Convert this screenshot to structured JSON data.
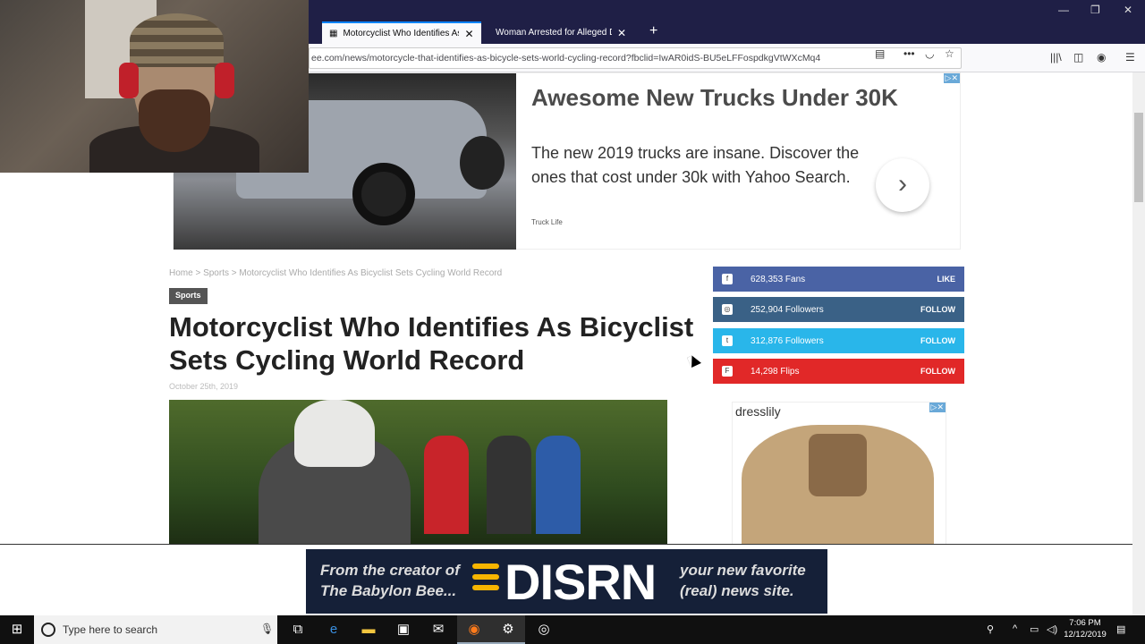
{
  "browser": {
    "tabs": [
      {
        "label": "Motorcyclist Who Identifies As",
        "active": true
      },
      {
        "label": "Woman Arrested for Alleged Death",
        "active": false
      }
    ],
    "new_tab": "+",
    "tab_close": "✕",
    "url": "ee.com/news/motorcycle-that-identifies-as-bicycle-sets-world-cycling-record?fbclid=IwAR0idS-BU5eLFFospdkgVtWXcMq4",
    "window_controls": [
      "—",
      "❐",
      "✕"
    ]
  },
  "top_ad": {
    "title": "Awesome New Trucks Under 30K",
    "text": "The new 2019 trucks are insane. Discover the ones that cost under 30k with Yahoo Search.",
    "source": "Truck Life",
    "arrow": "›",
    "adchoice": "▷✕"
  },
  "article": {
    "breadcrumb": "Home > Sports > Motorcyclist Who Identifies As Bicyclist Sets Cycling World Record",
    "category": "Sports",
    "title": "Motorcyclist Who Identifies As Bicyclist Sets Cycling World Record",
    "date": "October 25th, 2019"
  },
  "social": [
    {
      "icon": "f",
      "count": "628,353 Fans",
      "action": "LIKE",
      "color": "#4a63a5"
    },
    {
      "icon": "◎",
      "count": "252,904 Followers",
      "action": "FOLLOW",
      "color": "#3a6186"
    },
    {
      "icon": "t",
      "count": "312,876 Followers",
      "action": "FOLLOW",
      "color": "#29b6ea"
    },
    {
      "icon": "F",
      "count": "14,298 Flips",
      "action": "FOLLOW",
      "color": "#e12828"
    }
  ],
  "side_ad": {
    "brand": "dresslily",
    "adchoice": "▷✕"
  },
  "banner": {
    "left": "From the creator of The Babylon Bee...",
    "logo": "DISRN",
    "right": "your new favorite (real) news site."
  },
  "taskbar": {
    "search_placeholder": "Type here to search",
    "time": "7:06 PM",
    "date": "12/12/2019"
  },
  "colors": {
    "titlebar": "#1f1f46",
    "banner_bg": "#152038",
    "banner_accent": "#f7b500"
  }
}
